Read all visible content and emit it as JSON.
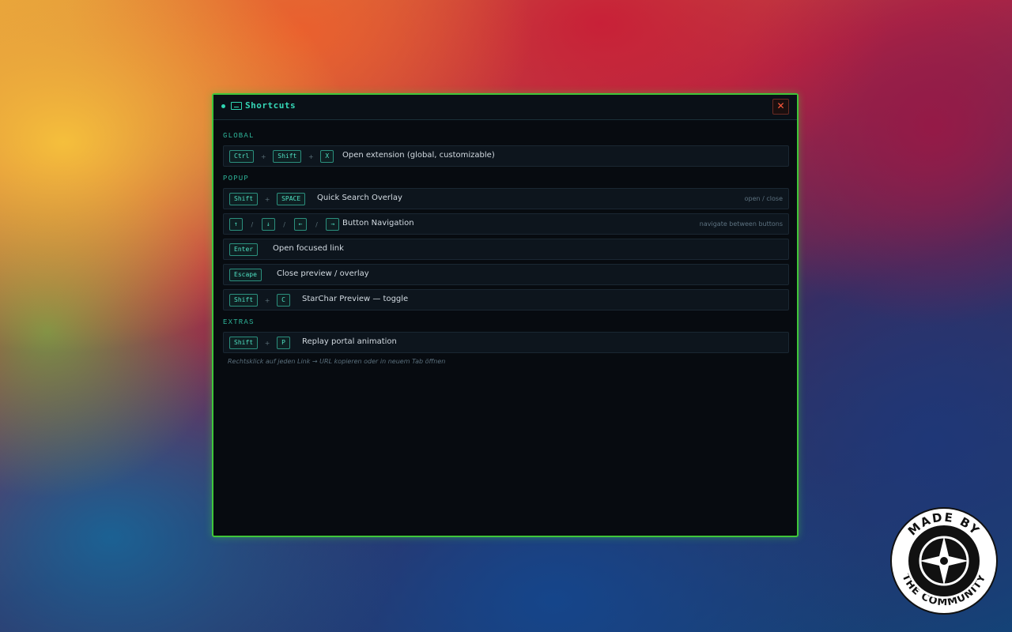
{
  "dialog": {
    "title": "Shortcuts",
    "close_label": "✕"
  },
  "sections": [
    {
      "title": "GLOBAL",
      "rows": [
        {
          "keys": [
            "Ctrl",
            "Shift",
            "X"
          ],
          "separators": [
            "+",
            "+"
          ],
          "label": "Open extension (global, customizable)",
          "hint": ""
        }
      ]
    },
    {
      "title": "POPUP",
      "rows": [
        {
          "keys": [
            "Shift",
            "SPACE"
          ],
          "separators": [
            "+"
          ],
          "label": "Quick Search Overlay",
          "hint": "open / close"
        },
        {
          "keys": [
            "↑",
            "↓",
            "←",
            "→"
          ],
          "separators": [
            "/",
            "/",
            "/"
          ],
          "label": "Button Navigation",
          "hint": "navigate between buttons"
        },
        {
          "keys": [
            "Enter"
          ],
          "separators": [],
          "label": "Open focused link",
          "hint": ""
        },
        {
          "keys": [
            "Escape"
          ],
          "separators": [],
          "label": "Close preview / overlay",
          "hint": ""
        },
        {
          "keys": [
            "Shift",
            "C"
          ],
          "separators": [
            "+"
          ],
          "label": "StarChar Preview — toggle",
          "hint": ""
        }
      ]
    },
    {
      "title": "EXTRAS",
      "rows": [
        {
          "keys": [
            "Shift",
            "P"
          ],
          "separators": [
            "+"
          ],
          "label": "Replay portal animation",
          "hint": ""
        }
      ]
    }
  ],
  "footnote": "Rechtsklick auf jeden Link → URL kopieren oder in neuem Tab öffnen",
  "badge": {
    "top_text": "MADE BY",
    "bottom_text": "THE COMMUNITY",
    "icon": "star-citizen-logo-icon"
  },
  "colors": {
    "accent": "#35d7b7",
    "border": "#3fc63a",
    "close": "#ff5a3c",
    "panel_bg": "#070b10"
  }
}
